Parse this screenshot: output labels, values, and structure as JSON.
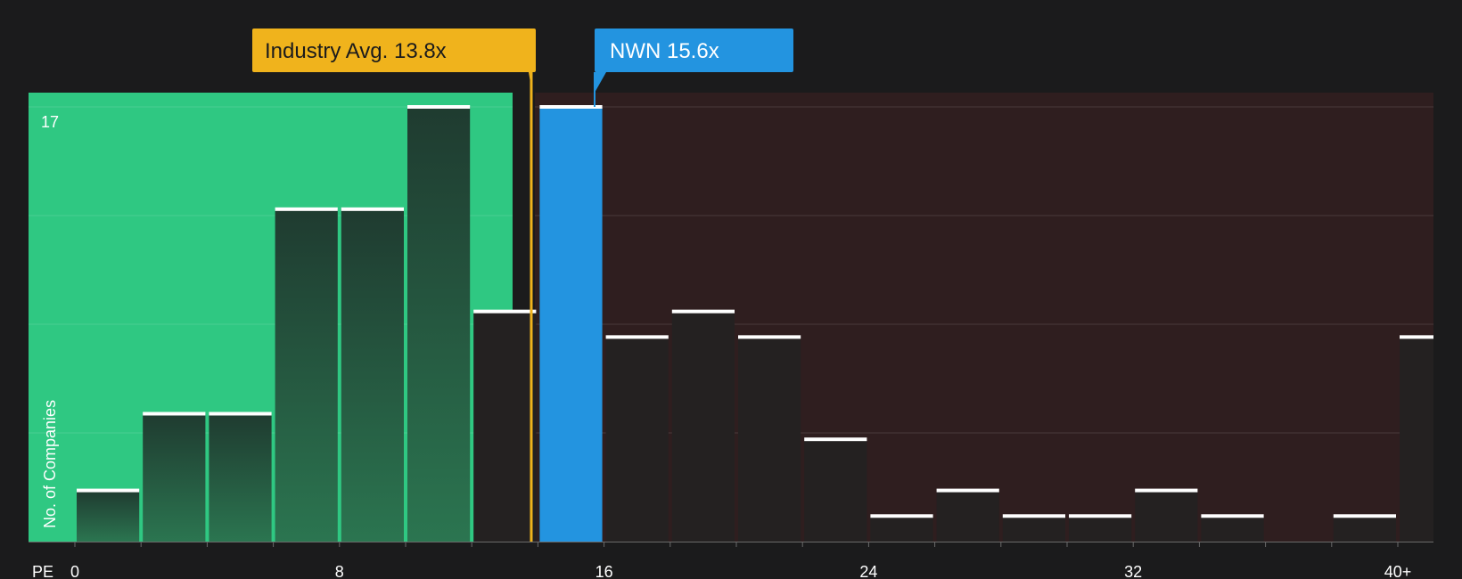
{
  "chart_data": {
    "type": "bar",
    "ylabel": "No. of Companies",
    "xlabel": "PE",
    "x_ticks": [
      "0",
      "8",
      "16",
      "24",
      "32",
      "40+"
    ],
    "ymax_label": "17",
    "ylim": [
      0,
      17
    ],
    "bin_width": 2,
    "bins": [
      {
        "start": 0,
        "count": 2
      },
      {
        "start": 2,
        "count": 5
      },
      {
        "start": 4,
        "count": 5
      },
      {
        "start": 6,
        "count": 13
      },
      {
        "start": 8,
        "count": 13
      },
      {
        "start": 10,
        "count": 17
      },
      {
        "start": 12,
        "count": 9
      },
      {
        "start": 14,
        "count": 17
      },
      {
        "start": 16,
        "count": 8
      },
      {
        "start": 18,
        "count": 9
      },
      {
        "start": 20,
        "count": 8
      },
      {
        "start": 22,
        "count": 4
      },
      {
        "start": 24,
        "count": 1
      },
      {
        "start": 26,
        "count": 2
      },
      {
        "start": 28,
        "count": 1
      },
      {
        "start": 30,
        "count": 1
      },
      {
        "start": 32,
        "count": 2
      },
      {
        "start": 34,
        "count": 1
      },
      {
        "start": 36,
        "count": 0
      },
      {
        "start": 38,
        "count": 1
      },
      {
        "start": 40,
        "count": 8
      }
    ],
    "industry_avg": {
      "label": "Industry Avg. 13.8x",
      "value": 13.8
    },
    "company": {
      "label": "NWN 15.6x",
      "value": 15.6
    },
    "colors": {
      "background": "#1b1b1c",
      "undervalued_zone": "#2fc882",
      "overvalued_zone": "#2f1e1f",
      "bar_in_green_top": "#1f3b30",
      "bar_in_green_bottom": "#2b7550",
      "bar_dark": "#242121",
      "bar_company": "#2394e0",
      "industry_marker": "#f0b31c",
      "company_marker": "#2394e0",
      "cap": "#ffffff",
      "gridline": "#4a3a3b"
    },
    "grid": true
  }
}
